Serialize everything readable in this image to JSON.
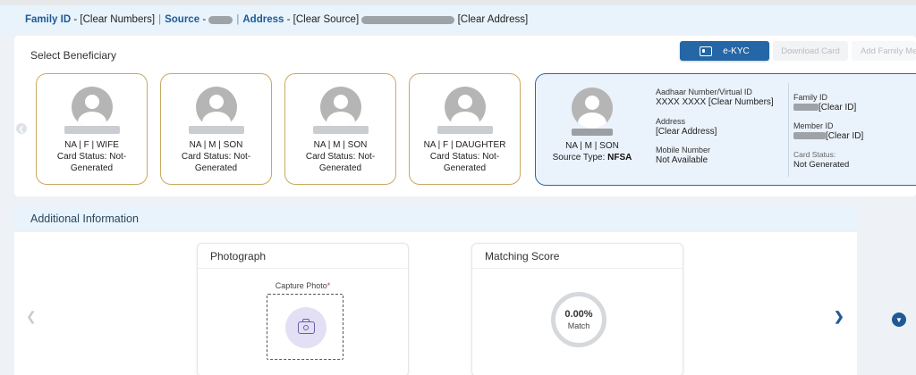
{
  "header": {
    "family_id_label": "Family ID",
    "family_id_value": "[Clear Numbers]",
    "source_label": "Source",
    "address_label": "Address",
    "address_value_1": "[Clear Source]",
    "address_value_2": "[Clear Address]",
    "separator": "|",
    "dash": "-"
  },
  "beneficiary_panel": {
    "title": "Select Beneficiary",
    "actions": {
      "ekyc": "e-KYC",
      "download_card": "Download Card",
      "add_family_member": "Add Family Mem"
    },
    "cards": [
      {
        "line1": "NA | F | WIFE",
        "line2": "Card Status: Not-",
        "line3": "Generated"
      },
      {
        "line1": "NA | M | SON",
        "line2": "Card Status: Not-",
        "line3": "Generated"
      },
      {
        "line1": "NA | M | SON",
        "line2": "Card Status: Not-",
        "line3": "Generated"
      },
      {
        "line1": "NA | F | DAUGHTER",
        "line2": "Card Status: Not-",
        "line3": "Generated"
      }
    ],
    "selected": {
      "line1": "NA | M | SON",
      "source_type_label": "Source Type:",
      "source_type_value": "NFSA",
      "aadhaar_label": "Aadhaar Number/Virtual ID",
      "aadhaar_value": "XXXX XXXX [Clear Numbers]",
      "address_label": "Address",
      "address_value": "[Clear Address]",
      "mobile_label": "Mobile Number",
      "mobile_value": "Not Available",
      "family_id_label": "Family ID",
      "family_id_value": "[Clear ID]",
      "member_id_label": "Member ID",
      "member_id_value": "[Clear ID]",
      "card_status_label": "Card Status:",
      "card_status_value": "Not Generated"
    }
  },
  "additional_panel": {
    "title": "Additional Information",
    "photograph": {
      "title": "Photograph",
      "capture_label": "Capture Photo",
      "required_mark": "*"
    },
    "matching": {
      "title": "Matching Score",
      "score": "0.00%",
      "score_label": "Match"
    }
  },
  "icons": [
    "idcard-icon",
    "camera-icon",
    "chevron-left-icon",
    "chevron-right-icon",
    "chevron-down-icon",
    "avatar-icon"
  ],
  "colors": {
    "primary": "#2466a6",
    "card_border": "#c9a961",
    "selected_bg": "#eaf2fb",
    "header_bg": "#e8f3fb"
  }
}
